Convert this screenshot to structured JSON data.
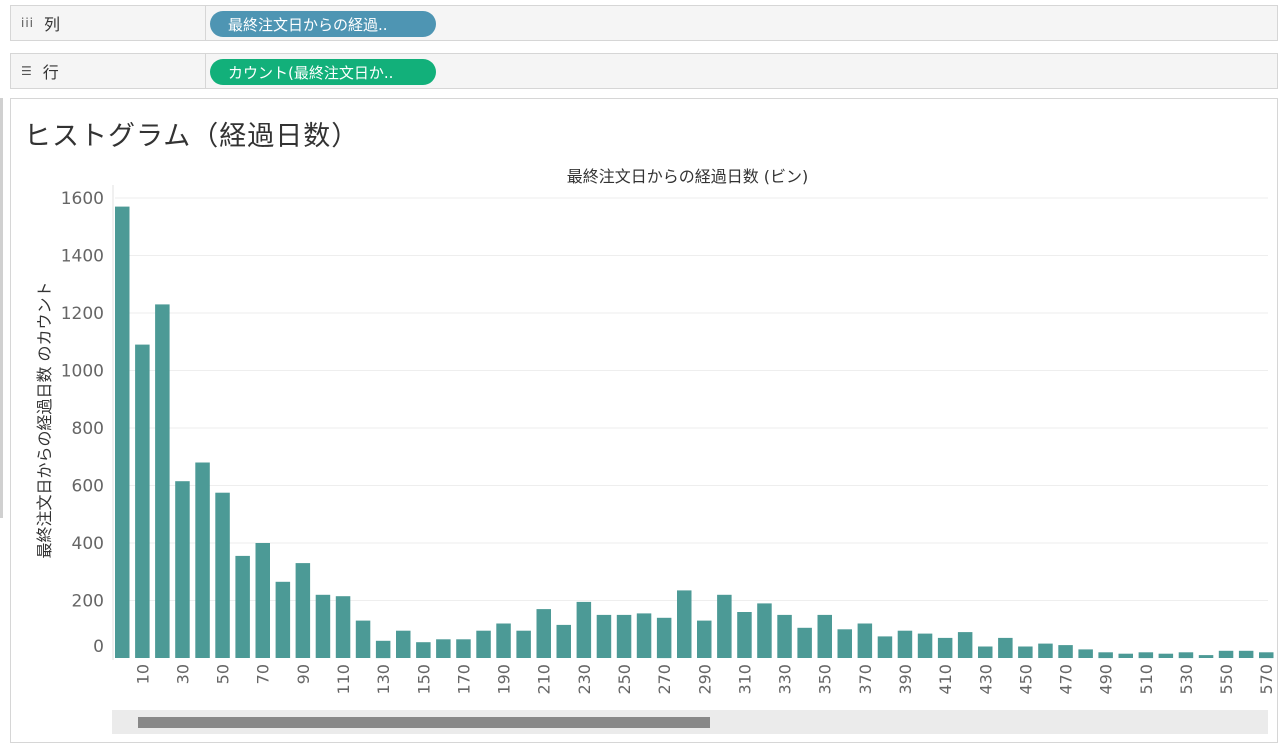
{
  "shelves": {
    "columns": {
      "label": "列",
      "pill": "最終注文日からの経過.."
    },
    "rows": {
      "label": "行",
      "pill": "カウント(最終注文日か.."
    }
  },
  "sheet": {
    "title": "ヒストグラム（経過日数）"
  },
  "colors": {
    "bar": "#4c9a96",
    "pill_columns": "#4e95b3",
    "pill_rows": "#12b07a"
  },
  "chart_data": {
    "type": "bar",
    "title": "最終注文日からの経過日数 (ビン)",
    "ylabel": "最終注文日からの経過日数 のカウント",
    "xlabel": "",
    "ylim": [
      0,
      1600
    ],
    "yticks": [
      0,
      200,
      400,
      600,
      800,
      1000,
      1200,
      1400,
      1600
    ],
    "grid": true,
    "categories": [
      0,
      10,
      20,
      30,
      40,
      50,
      60,
      70,
      80,
      90,
      100,
      110,
      120,
      130,
      140,
      150,
      160,
      170,
      180,
      190,
      200,
      210,
      220,
      230,
      240,
      250,
      260,
      270,
      280,
      290,
      300,
      310,
      320,
      330,
      340,
      350,
      360,
      370,
      380,
      390,
      400,
      410,
      420,
      430,
      440,
      450,
      460,
      470,
      480,
      490,
      500,
      510,
      520,
      530,
      540,
      550,
      560,
      570
    ],
    "xtick_labels": [
      "10",
      "30",
      "50",
      "70",
      "90",
      "110",
      "130",
      "150",
      "170",
      "190",
      "210",
      "230",
      "250",
      "270",
      "290",
      "310",
      "330",
      "350",
      "370",
      "390",
      "410",
      "430",
      "450",
      "470",
      "490",
      "510",
      "530",
      "550",
      "570"
    ],
    "values": [
      1570,
      1090,
      1230,
      615,
      680,
      575,
      355,
      400,
      265,
      330,
      220,
      215,
      130,
      60,
      95,
      55,
      65,
      65,
      95,
      120,
      95,
      170,
      115,
      195,
      150,
      150,
      155,
      140,
      235,
      130,
      220,
      160,
      190,
      150,
      105,
      150,
      100,
      120,
      75,
      95,
      85,
      70,
      90,
      40,
      70,
      40,
      50,
      45,
      30,
      20,
      15,
      20,
      15,
      20,
      10,
      25,
      25,
      20
    ]
  }
}
